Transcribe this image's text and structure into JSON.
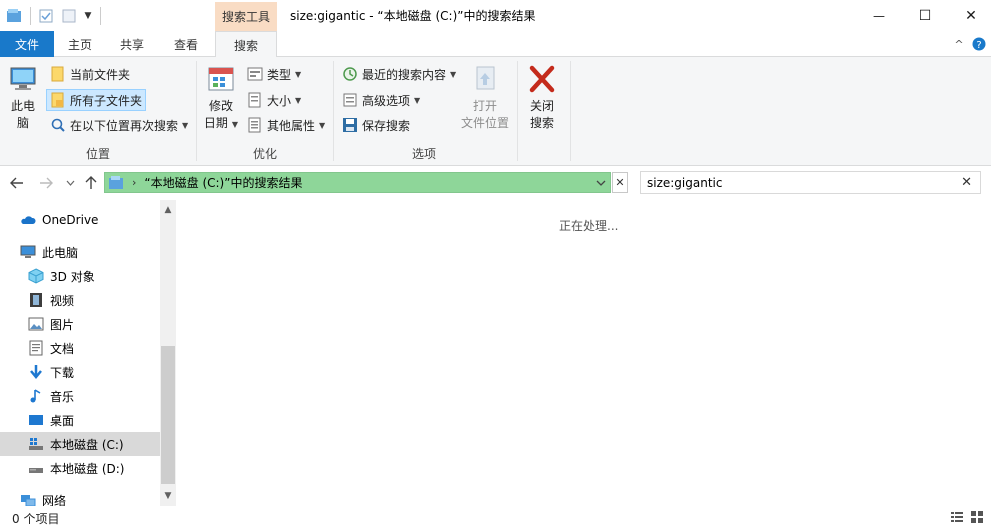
{
  "window": {
    "title": "size:gigantic - “本地磁盘 (C:)”中的搜索结果",
    "context_group": "搜索工具",
    "minimize_glyph": "—",
    "maximize_glyph": "☐",
    "close_glyph": "✕"
  },
  "ribbon_tabs": {
    "file": "文件",
    "home": "主页",
    "share": "共享",
    "view": "查看",
    "search": "搜索",
    "collapse_glyph": "^",
    "help_glyph": "?"
  },
  "ribbon": {
    "location": {
      "this_pc_line1": "此电",
      "this_pc_line2": "脑",
      "current_folder": "当前文件夹",
      "all_subfolders": "所有子文件夹",
      "search_again": "在以下位置再次搜索",
      "label": "位置"
    },
    "refine": {
      "date_modified_line1": "修改",
      "date_modified_line2": "日期",
      "kind": "类型",
      "size": "大小",
      "other_properties": "其他属性",
      "label": "优化"
    },
    "options": {
      "recent_searches": "最近的搜索内容",
      "advanced_options": "高级选项",
      "save_search": "保存搜索",
      "open_location_line1": "打开",
      "open_location_line2": "文件位置",
      "label": "选项"
    },
    "close": {
      "line1": "关闭",
      "line2": "搜索"
    }
  },
  "address_bar": {
    "path": "“本地磁盘 (C:)”中的搜索结果",
    "clear_glyph": "✕"
  },
  "search_box": {
    "value": "size:gigantic",
    "clear_glyph": "✕"
  },
  "nav_pane": {
    "onedrive": "OneDrive",
    "this_pc": "此电脑",
    "objects_3d": "3D 对象",
    "videos": "视频",
    "pictures": "图片",
    "documents": "文档",
    "downloads": "下载",
    "music": "音乐",
    "desktop": "桌面",
    "local_disk_c": "本地磁盘 (C:)",
    "local_disk_d": "本地磁盘 (D:)",
    "network": "网络"
  },
  "content": {
    "status_message": "正在处理..."
  },
  "status_bar": {
    "item_count": "0 个项目"
  },
  "colors": {
    "file_tab": "#1979ca",
    "context_tab": "#f9dcc4",
    "address_search_highlight": "#8ed699",
    "selection": "#cce8ff",
    "close_search_x": "#c42b1c"
  }
}
